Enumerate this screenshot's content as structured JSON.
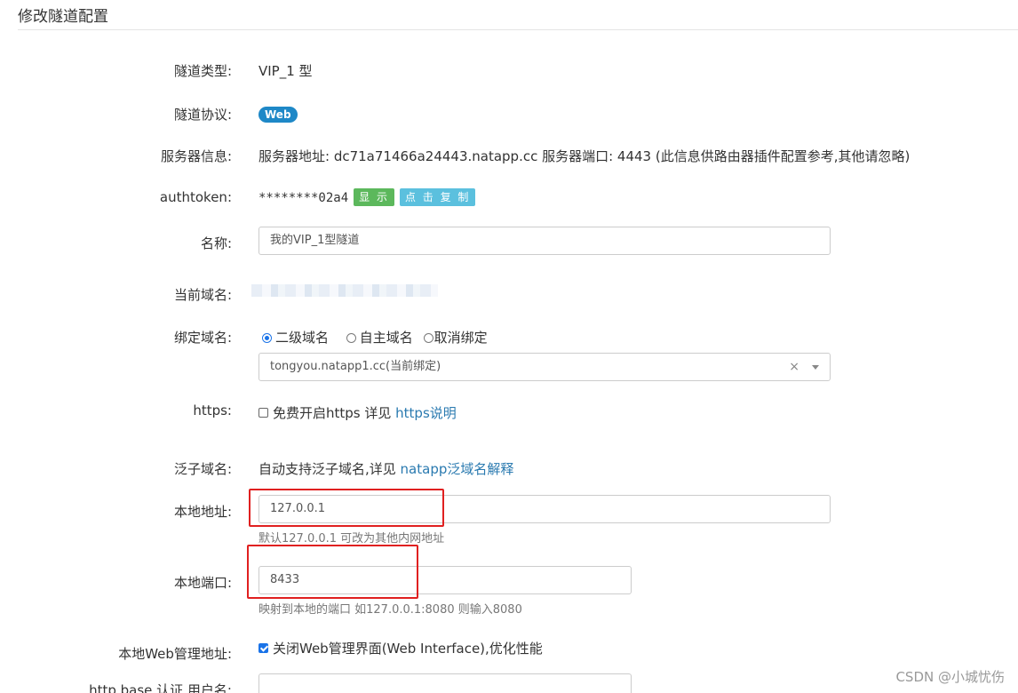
{
  "page": {
    "title": "修改隧道配置"
  },
  "fields": {
    "tunnel_type": {
      "label": "隧道类型:",
      "value": "VIP_1 型"
    },
    "tunnel_protocol": {
      "label": "隧道协议:",
      "badge": "Web"
    },
    "server_info": {
      "label": "服务器信息:",
      "value": "服务器地址: dc71a71466a24443.natapp.cc 服务器端口: 4443 (此信息供路由器插件配置参考,其他请忽略)"
    },
    "authtoken": {
      "label": "authtoken:",
      "masked": "********02a4",
      "show_button": "显 示",
      "copy_button": "点 击 复 制"
    },
    "name": {
      "label": "名称:",
      "value": "我的VIP_1型隧道"
    },
    "current_domain": {
      "label": "当前域名:"
    },
    "bind_domain": {
      "label": "绑定域名:",
      "options": [
        "二级域名",
        "自主域名",
        "取消绑定"
      ],
      "selected_index": 0,
      "select_value": "tongyou.natapp1.cc(当前绑定)",
      "clear_glyph": "×"
    },
    "https": {
      "label": "https:",
      "checked": false,
      "text": "免费开启https 详见 ",
      "link": "https说明"
    },
    "wildcard": {
      "label": "泛子域名:",
      "text": "自动支持泛子域名,详见 ",
      "link": "natapp泛域名解释"
    },
    "local_address": {
      "label": "本地地址:",
      "value": "127.0.0.1",
      "help": "默认127.0.0.1 可改为其他内网地址"
    },
    "local_port": {
      "label": "本地端口:",
      "value": "8433",
      "help": "映射到本地的端口 如127.0.0.1:8080 则输入8080"
    },
    "web_admin": {
      "label": "本地Web管理地址:",
      "checked": true,
      "text": "关闭Web管理界面(Web Interface),优化性能"
    },
    "http_auth_user": {
      "label": "http base 认证 用户名:",
      "value": ""
    }
  },
  "watermark": "CSDN @小城忧伤",
  "colors": {
    "accent": "#1e88c7",
    "link": "#2a7ab0",
    "highlight_box": "#e02020",
    "btn_show": "#5cb85c",
    "btn_copy": "#5bc0de"
  }
}
